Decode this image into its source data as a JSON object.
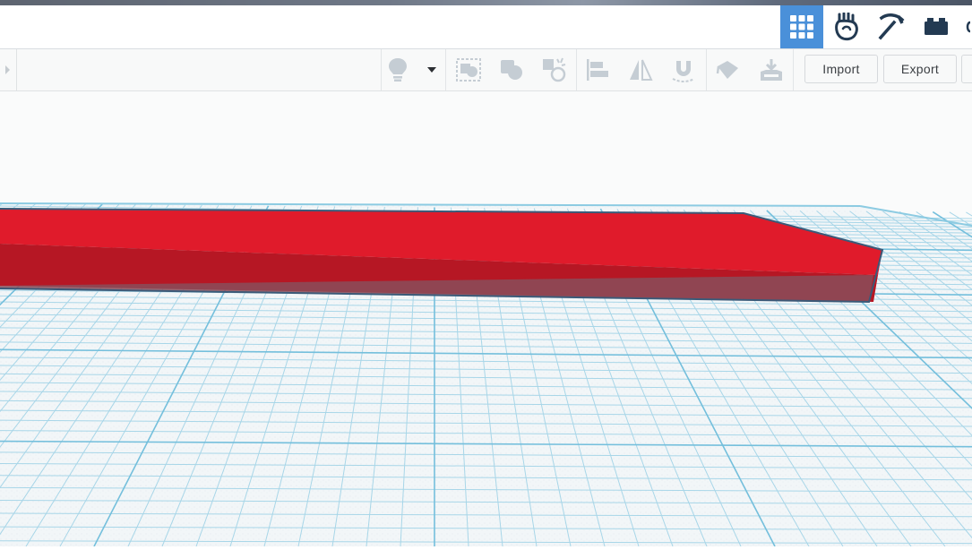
{
  "topbar": {
    "view_tabs": [
      {
        "name": "3d-design-view",
        "icon": "grid-icon",
        "active": true
      },
      {
        "name": "codeblocks-view",
        "icon": "hand-icon",
        "active": false
      },
      {
        "name": "minecraft-view",
        "icon": "pickaxe-icon",
        "active": false
      },
      {
        "name": "lego-view",
        "icon": "brick-icon",
        "active": false
      }
    ]
  },
  "toolbar": {
    "icons": [
      "chevron-right-icon",
      "lightbulb-icon",
      "caret-down-icon",
      "group-icon",
      "ungroup-icon",
      "hole-icon",
      "align-icon",
      "mirror-icon",
      "magnet-icon",
      "paint-icon",
      "import-tray-icon"
    ],
    "import_label": "Import",
    "export_label": "Export"
  },
  "colors": {
    "accent": "#4a90d9",
    "shape_top": "#e01b2b",
    "shape_front": "#b61724",
    "grid_line": "#9fd2e6",
    "grid_major": "#6bbad9"
  }
}
